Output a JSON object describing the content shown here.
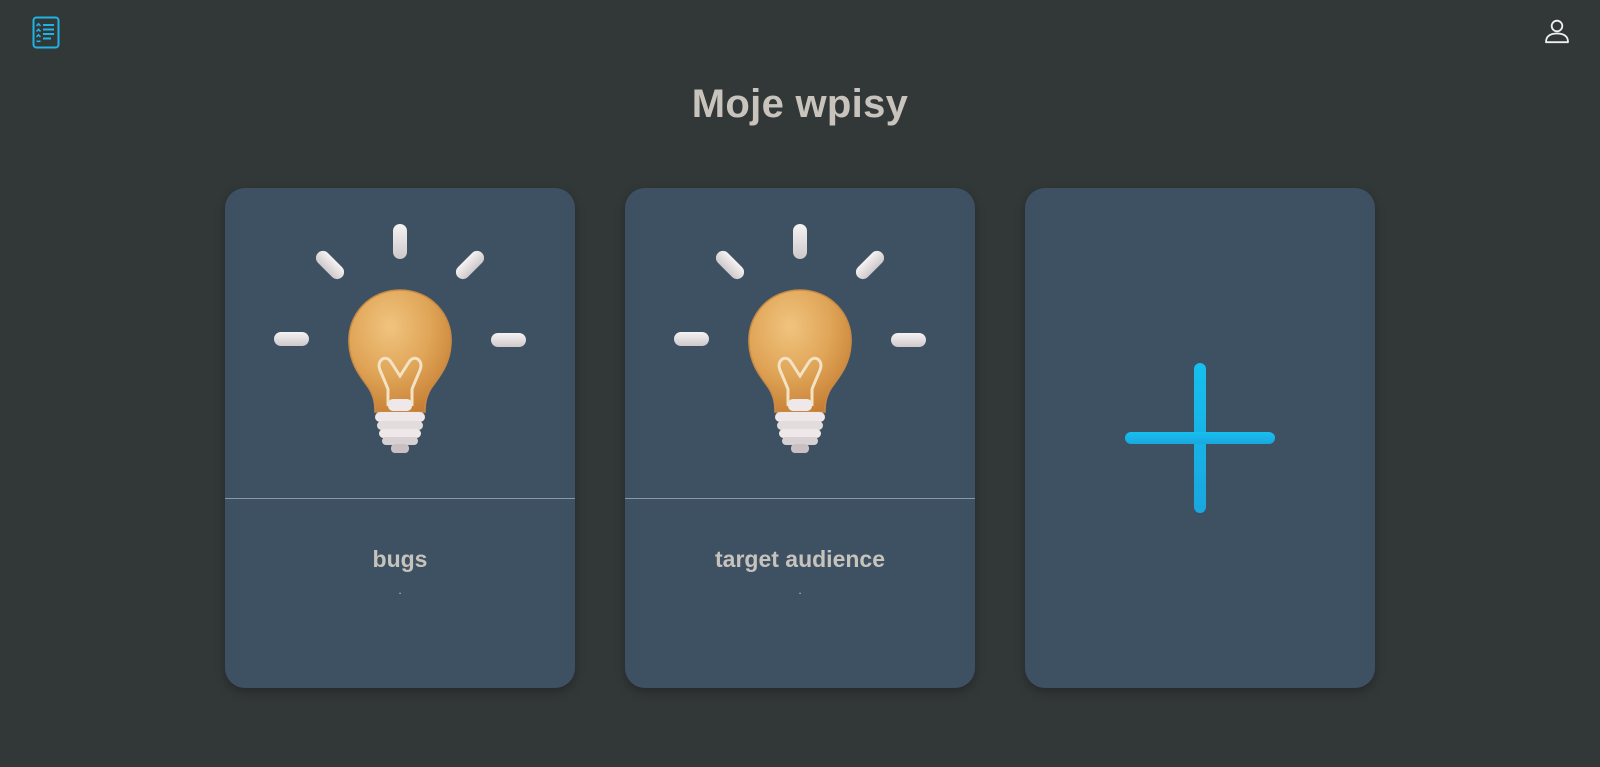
{
  "header": {
    "logo_icon": "notebook-list-icon",
    "profile_icon": "user-profile-icon"
  },
  "main": {
    "title": "Moje wpisy",
    "entries": [
      {
        "title": "bugs",
        "description": ".",
        "image": "lightbulb-illustration"
      },
      {
        "title": "target audience",
        "description": ".",
        "image": "lightbulb-illustration"
      }
    ],
    "add_icon": "plus-icon"
  },
  "colors": {
    "background": "#323737",
    "card": "#3e5163",
    "accent": "#17b6ea",
    "text": "#c8c4bd"
  }
}
